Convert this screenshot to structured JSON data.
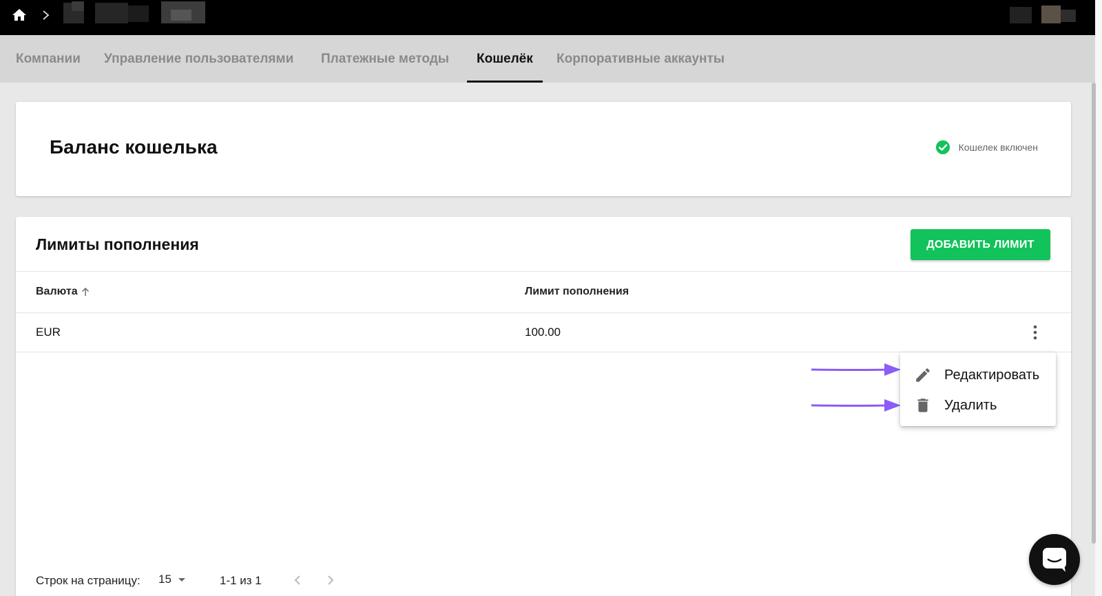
{
  "tabs": [
    {
      "label": "Компании",
      "active": false
    },
    {
      "label": "Управление пользователями",
      "active": false
    },
    {
      "label": "Платежные методы",
      "active": false
    },
    {
      "label": "Кошелёк",
      "active": true
    },
    {
      "label": "Корпоративные аккаунты",
      "active": false
    }
  ],
  "balance": {
    "title": "Баланс кошелька",
    "status_label": "Кошелек включен"
  },
  "limits": {
    "title": "Лимиты пополнения",
    "add_button_label": "ДОБАВИТЬ ЛИМИТ",
    "columns": [
      "Валюта",
      "Лимит пополнения"
    ],
    "rows": [
      {
        "currency": "EUR",
        "limit": "100.00"
      }
    ]
  },
  "row_menu": {
    "items": [
      {
        "label": "Редактировать",
        "icon": "pencil-icon"
      },
      {
        "label": "Удалить",
        "icon": "trash-icon"
      }
    ]
  },
  "pagination": {
    "rows_per_page_label": "Строк на страницу:",
    "rows_per_page_value": "15",
    "range_label": "1-1 из 1"
  },
  "colors": {
    "accent_green": "#12c25a",
    "arrow_purple": "#8b5cf6",
    "topbar": "#000000"
  }
}
